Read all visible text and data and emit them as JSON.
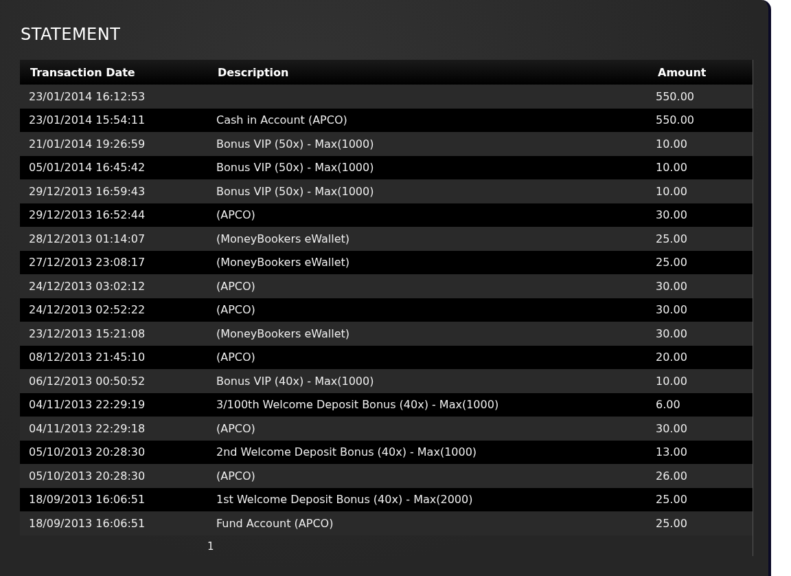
{
  "title": "STATEMENT",
  "table": {
    "columns": [
      "Transaction Date",
      "Description",
      "Amount"
    ],
    "rows": [
      [
        "23/01/2014 16:12:53",
        "",
        "550.00"
      ],
      [
        "23/01/2014 15:54:11",
        "Cash in Account (APCO)",
        "550.00"
      ],
      [
        "21/01/2014 19:26:59",
        "Bonus VIP (50x) - Max(1000)",
        "10.00"
      ],
      [
        "05/01/2014 16:45:42",
        "Bonus VIP (50x) - Max(1000)",
        "10.00"
      ],
      [
        "29/12/2013 16:59:43",
        "Bonus VIP (50x) - Max(1000)",
        "10.00"
      ],
      [
        "29/12/2013 16:52:44",
        "(APCO)",
        "30.00"
      ],
      [
        "28/12/2013 01:14:07",
        "(MoneyBookers eWallet)",
        "25.00"
      ],
      [
        "27/12/2013 23:08:17",
        "(MoneyBookers eWallet)",
        "25.00"
      ],
      [
        "24/12/2013 03:02:12",
        "(APCO)",
        "30.00"
      ],
      [
        "24/12/2013 02:52:22",
        "(APCO)",
        "30.00"
      ],
      [
        "23/12/2013 15:21:08",
        "(MoneyBookers eWallet)",
        "30.00"
      ],
      [
        "08/12/2013 21:45:10",
        "(APCO)",
        "20.00"
      ],
      [
        "06/12/2013 00:50:52",
        "Bonus VIP (40x) - Max(1000)",
        "10.00"
      ],
      [
        "04/11/2013 22:29:19",
        "3/100th Welcome Deposit Bonus (40x) - Max(1000)",
        "6.00"
      ],
      [
        "04/11/2013 22:29:18",
        "(APCO)",
        "30.00"
      ],
      [
        "05/10/2013 20:28:30",
        "2nd Welcome Deposit Bonus (40x) - Max(1000)",
        "13.00"
      ],
      [
        "05/10/2013 20:28:30",
        "(APCO)",
        "26.00"
      ],
      [
        "18/09/2013 16:06:51",
        "1st Welcome Deposit Bonus (40x) - Max(2000)",
        "25.00"
      ],
      [
        "18/09/2013 16:06:51",
        "Fund Account (APCO)",
        "25.00"
      ]
    ]
  },
  "pagination": {
    "pages": [
      "1"
    ]
  }
}
